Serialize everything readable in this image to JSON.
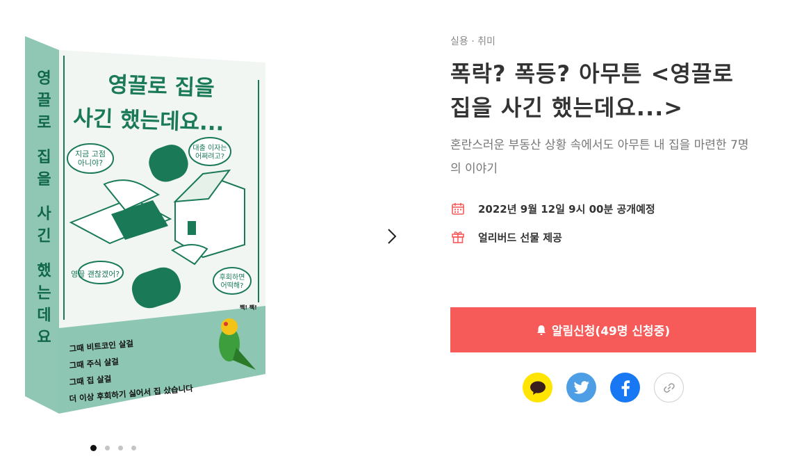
{
  "book": {
    "cover_title_line1": "영끌로 집을",
    "cover_title_line2": "사긴 했는데요...",
    "spine_text": "영끌로 집을 사긴 했는데요",
    "bubble_1": "지금 고점\n아니야?",
    "bubble_2": "대출 이자는\n어쩌려고?",
    "bubble_3": "영끌 괜찮겠어?",
    "bubble_4": "후회하면\n어떡해?",
    "bird_text": "짹! 짹!",
    "lines": [
      "그때 비트코인 살걸",
      "그때 주식 살걸",
      "그때 집 살걸",
      "더 이상 후회하기 싫어서 집 샀습니다"
    ]
  },
  "carousel": {
    "dot_count": 4,
    "active_index": 0
  },
  "product": {
    "category": "실용 · 취미",
    "title": "폭락? 폭등? 아무튼 <영끌로 집을 사긴 했는데요...>",
    "subtitle": "혼란스러운 부동산 상황 속에서도 아무튼 내 집을 마련한 7명의 이야기",
    "schedule": "2022년 9월 12일 9시 00분 공개예정",
    "gift": "얼리버드 선물 제공"
  },
  "cta": {
    "label": "알림신청(49명 신청중)"
  },
  "share": {
    "kakao_icon": "kakao-talk-icon",
    "twitter_icon": "twitter-bird-icon",
    "facebook_icon": "facebook-f-icon",
    "link_icon": "link-chain-icon"
  },
  "colors": {
    "accent": "#f65a59",
    "book_mint": "#8dc6b3",
    "cover_green": "#1a7a58"
  }
}
